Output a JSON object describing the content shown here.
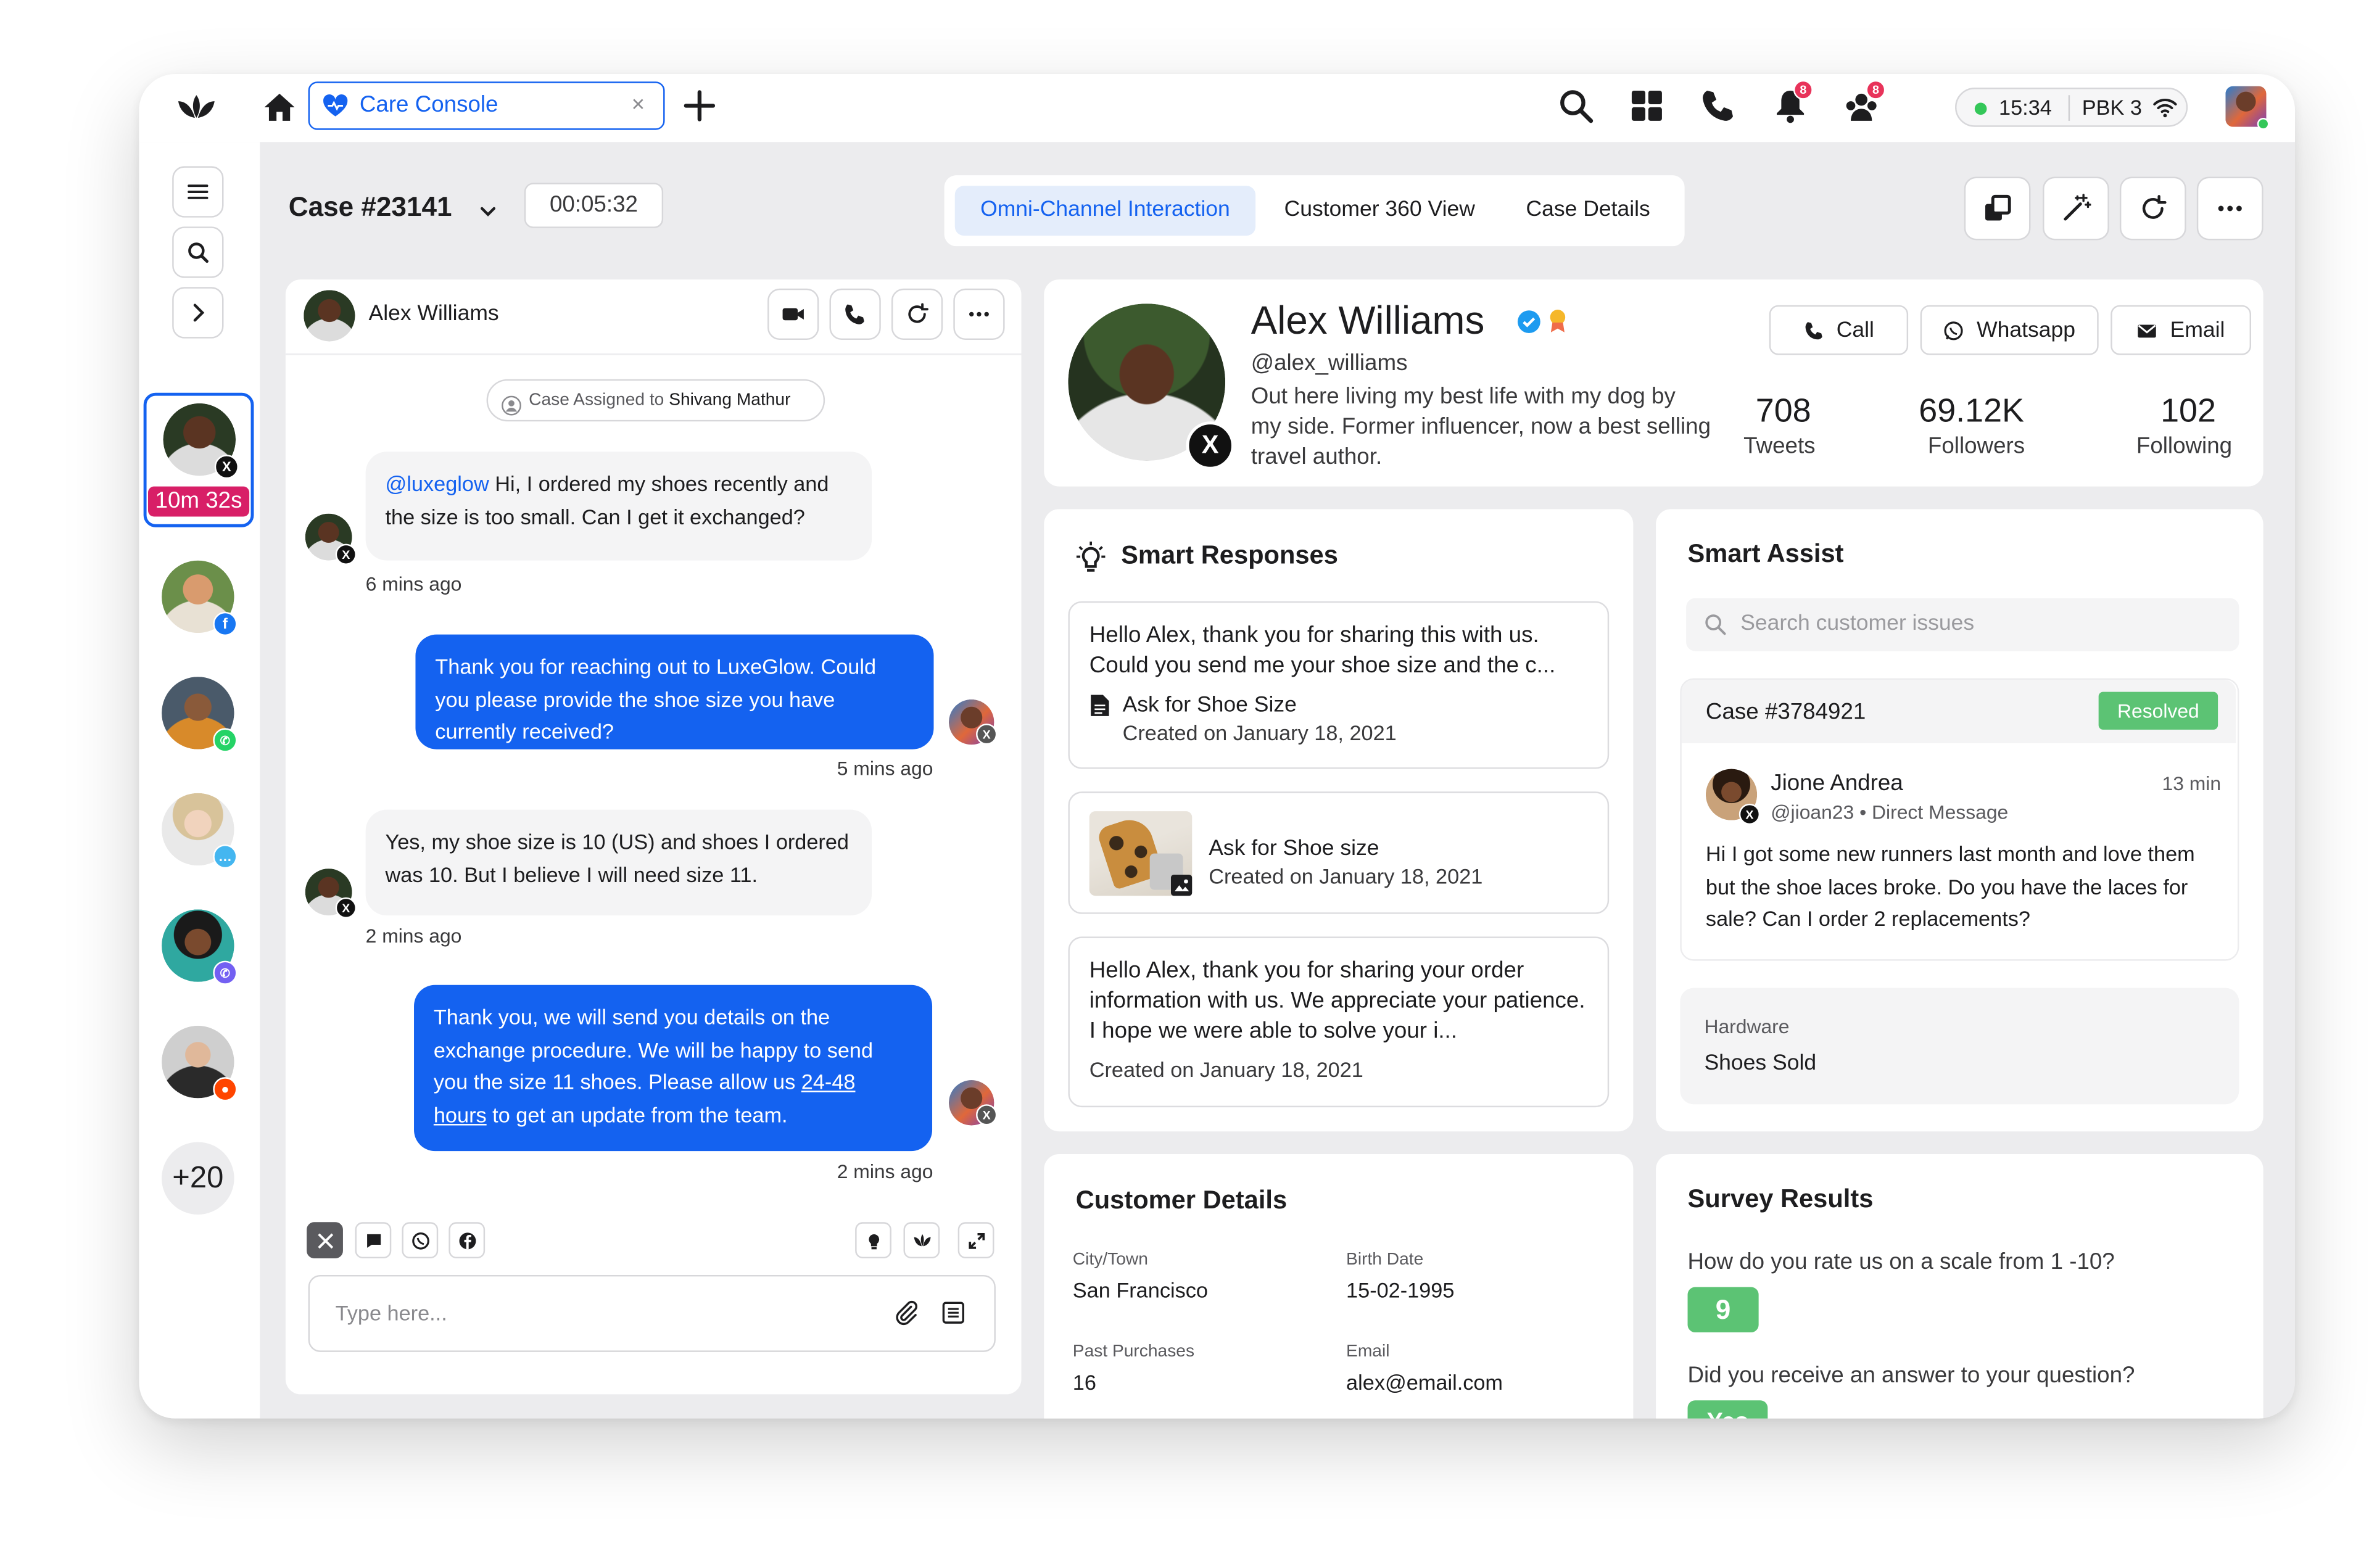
{
  "topbar": {
    "tab_title": "Care Console",
    "time": "15:34",
    "extension": "PBK 3",
    "notifications_count": "8",
    "team_count": "8"
  },
  "case": {
    "number": "Case #23141",
    "timer": "00:05:32"
  },
  "view_tabs": [
    {
      "label": "Omni-Channel Interaction",
      "active": true
    },
    {
      "label": "Customer 360 View",
      "active": false
    },
    {
      "label": "Case Details",
      "active": false
    }
  ],
  "rail": {
    "active_timer": "10m 32s",
    "more_count": "+20"
  },
  "conversation": {
    "contact_name": "Alex Williams",
    "system_prefix": "Case Assigned to",
    "system_assignee": "Shivang Mathur",
    "messages": [
      {
        "dir": "in",
        "mention": "@luxeglow",
        "text": " Hi, I ordered my shoes recently and the size is too small. Can I get it exchanged?",
        "time": "6 mins ago"
      },
      {
        "dir": "out",
        "text": "Thank you for reaching out to LuxeGlow. Could you please provide the shoe size you have currently received?",
        "time": "5 mins ago"
      },
      {
        "dir": "in",
        "text": "Yes, my shoe size is 10 (US) and shoes I ordered was 10. But I believe I will need size 11.",
        "time": "2 mins ago"
      },
      {
        "dir": "out",
        "text_before": "Thank you, we will send you details on the exchange procedure. We will be happy to send you the size 11 shoes. Please allow us ",
        "link": "24-48 hours",
        "text_after": " to get an update from the team.",
        "time": "2 mins ago"
      }
    ],
    "input_placeholder": "Type here..."
  },
  "profile": {
    "name": "Alex Williams",
    "handle": "@alex_williams",
    "bio": "Out here living my best life with my dog by my side. Former influencer, now a best selling travel author.",
    "actions": [
      "Call",
      "Whatsapp",
      "Email"
    ],
    "stats": [
      {
        "value": "708",
        "label": "Tweets"
      },
      {
        "value": "69.12K",
        "label": "Followers"
      },
      {
        "value": "102",
        "label": "Following"
      }
    ]
  },
  "smart_responses": {
    "title": "Smart Responses",
    "items": [
      {
        "text": "Hello Alex, thank you for sharing this with us. Could you send me your shoe size and the c...",
        "doc_title": "Ask for Shoe Size",
        "created": "Created on January 18, 2021"
      },
      {
        "title": "Ask for Shoe size",
        "created": "Created on January 18, 2021"
      },
      {
        "text": "Hello Alex, thank you for sharing your order information with us. We appreciate your patience. I hope we were able to solve your i...",
        "created": "Created on January 18, 2021"
      }
    ]
  },
  "smart_assist": {
    "title": "Smart Assist",
    "search_placeholder": "Search customer issues",
    "case_number": "Case #3784921",
    "case_status": "Resolved",
    "author": "Jione Andrea",
    "author_meta": "@jioan23 • Direct Message",
    "age": "13 min",
    "message": "Hi I got some new runners last month and love them but the shoe laces broke. Do you have the laces for sale? Can I order 2 replacements?",
    "tag_label": "Hardware",
    "tag_value": "Shoes Sold"
  },
  "customer_details": {
    "title": "Customer Details",
    "fields": [
      {
        "label": "City/Town",
        "value": "San Francisco"
      },
      {
        "label": "Birth Date",
        "value": "15-02-1995"
      },
      {
        "label": "Past Purchases",
        "value": "16"
      },
      {
        "label": "Email",
        "value": "alex@email.com"
      }
    ]
  },
  "survey": {
    "title": "Survey Results",
    "q1": "How do you rate us on a scale from 1 -10?",
    "a1": "9",
    "q2": "Did you receive an answer to your question?",
    "a2": "Yes"
  },
  "colors": {
    "accent": "#1462f0",
    "resolved": "#5cc374",
    "timer_badge": "#d81f67",
    "notification": "#e8335a"
  }
}
